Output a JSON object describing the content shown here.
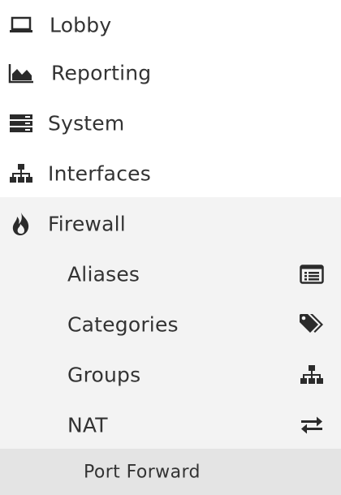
{
  "menu": {
    "items": [
      {
        "label": "Lobby",
        "icon": "laptop-icon"
      },
      {
        "label": "Reporting",
        "icon": "area-chart-icon"
      },
      {
        "label": "System",
        "icon": "server-icon"
      },
      {
        "label": "Interfaces",
        "icon": "sitemap-icon"
      },
      {
        "label": "Firewall",
        "icon": "fire-icon"
      }
    ],
    "firewall_submenu": [
      {
        "label": "Aliases",
        "icon": "list-alt-icon"
      },
      {
        "label": "Categories",
        "icon": "tags-icon"
      },
      {
        "label": "Groups",
        "icon": "sitemap-icon"
      },
      {
        "label": "NAT",
        "icon": "exchange-icon"
      }
    ],
    "nat_submenu": [
      {
        "label": "Port Forward"
      }
    ]
  },
  "colors": {
    "text": "#333333",
    "icon": "#2b2b2b",
    "section_background": "#f3f3f3",
    "active_background": "#e4e4e4"
  }
}
